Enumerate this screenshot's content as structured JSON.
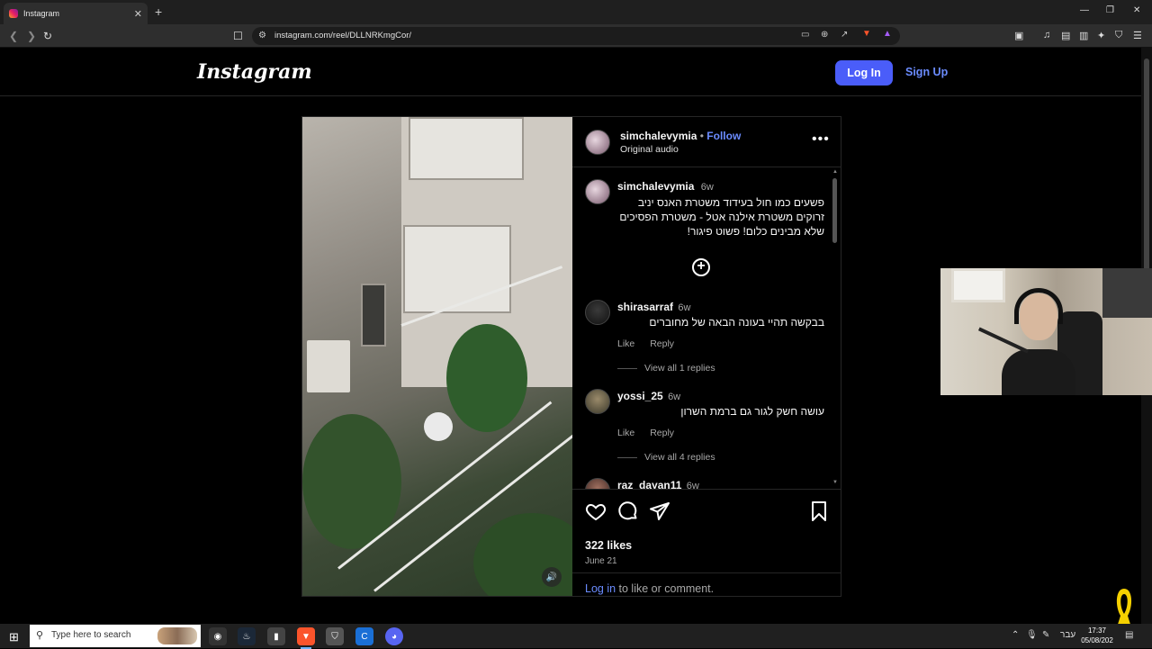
{
  "browser": {
    "tab_title": "Instagram",
    "url": "instagram.com/reel/DLLNRKmgCor/"
  },
  "header": {
    "logo": "Instagram",
    "login_label": "Log In",
    "signup_label": "Sign Up"
  },
  "post": {
    "author": "simchalevymia",
    "follow_label": "Follow",
    "audio": "Original audio",
    "caption": {
      "username": "simchalevymia",
      "age": "6w",
      "text": "פשעים כמו חול בעידוד משטרת האנס יניב זרוקים משטרת אילנה אטל - משטרת הפסיכים שלא מבינים כלום! פשוט פיגור!"
    },
    "comments": [
      {
        "username": "shirasarraf",
        "age": "6w",
        "text": "בבקשה תהיי בעונה הבאה של מחוברים",
        "like": "Like",
        "reply": "Reply",
        "view_replies": "View all 1 replies"
      },
      {
        "username": "yossi_25",
        "age": "6w",
        "text": "עושה חשק לגור גם ברמת השרון",
        "like": "Like",
        "reply": "Reply",
        "view_replies": "View all 4 replies"
      },
      {
        "username": "raz_dayan11",
        "age": "6w"
      }
    ],
    "likes": "322 likes",
    "date": "June 21",
    "login_link": "Log in",
    "login_suffix": " to like or comment."
  },
  "taskbar": {
    "search_placeholder": "Type here to search",
    "language": "עבר",
    "time": "17:37",
    "date": "05/08/202"
  },
  "colors": {
    "accent_blue": "#4a5df9",
    "link_blue": "#6b8cff",
    "background": "#000000"
  }
}
